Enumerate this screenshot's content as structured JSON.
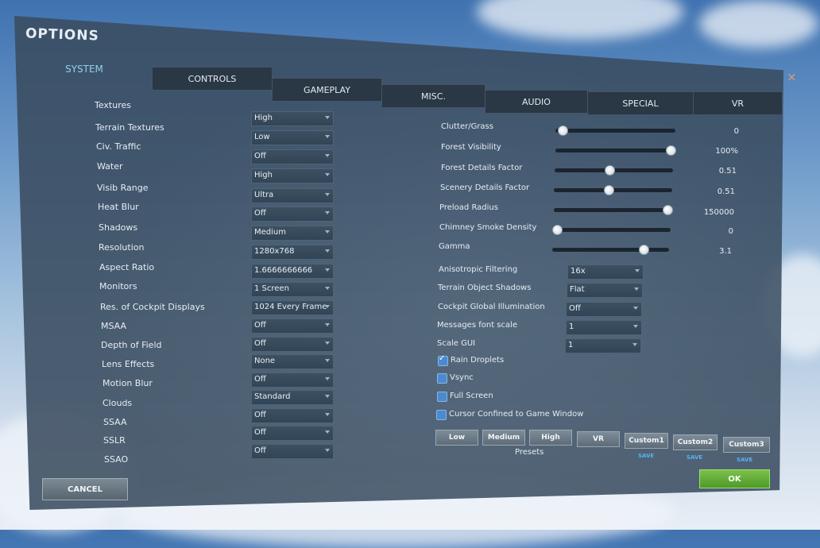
{
  "window": {
    "title": "OPTIONS",
    "close_glyph": "×"
  },
  "tabs": [
    {
      "label": "SYSTEM",
      "active": true
    },
    {
      "label": "CONTROLS"
    },
    {
      "label": "GAMEPLAY"
    },
    {
      "label": "MISC."
    },
    {
      "label": "AUDIO"
    },
    {
      "label": "SPECIAL"
    },
    {
      "label": "VR"
    }
  ],
  "left_settings": [
    {
      "label": "Textures",
      "value": "High"
    },
    {
      "label": "Terrain Textures",
      "value": "Low"
    },
    {
      "label": "Civ. Traffic",
      "value": "Off"
    },
    {
      "label": "Water",
      "value": "High"
    },
    {
      "label": "Visib Range",
      "value": "Ultra"
    },
    {
      "label": "Heat Blur",
      "value": "Off"
    },
    {
      "label": "Shadows",
      "value": "Medium"
    },
    {
      "label": "Resolution",
      "value": "1280x768"
    },
    {
      "label": "Aspect Ratio",
      "value": "1.6666666666"
    },
    {
      "label": "Monitors",
      "value": "1 Screen"
    },
    {
      "label": "Res. of Cockpit Displays",
      "value": "1024 Every Frame"
    },
    {
      "label": "MSAA",
      "value": "Off"
    },
    {
      "label": "Depth of Field",
      "value": "Off"
    },
    {
      "label": "Lens Effects",
      "value": "None"
    },
    {
      "label": "Motion Blur",
      "value": "Off"
    },
    {
      "label": "Clouds",
      "value": "Standard"
    },
    {
      "label": "SSAA",
      "value": "Off"
    },
    {
      "label": "SSLR",
      "value": "Off"
    },
    {
      "label": "SSAO",
      "value": "Off"
    }
  ],
  "sliders": [
    {
      "label": "Clutter/Grass",
      "value": "0",
      "level": 0.03
    },
    {
      "label": "Forest Visibility",
      "value": "100%",
      "level": 1.0
    },
    {
      "label": "Forest Details Factor",
      "value": "0.51",
      "level": 0.46
    },
    {
      "label": "Scenery Details Factor",
      "value": "0.51",
      "level": 0.46
    },
    {
      "label": "Preload Radius",
      "value": "150000",
      "level": 1.0
    },
    {
      "label": "Chimney Smoke Density",
      "value": "0",
      "level": 0.0
    },
    {
      "label": "Gamma",
      "value": "3.1",
      "level": 0.8
    }
  ],
  "right_dropdowns": [
    {
      "label": "Anisotropic Filtering",
      "value": "16x"
    },
    {
      "label": "Terrain Object Shadows",
      "value": "Flat"
    },
    {
      "label": "Cockpit Global Illumination",
      "value": "Off"
    },
    {
      "label": "Messages font scale",
      "value": "1"
    },
    {
      "label": "Scale GUI",
      "value": "1"
    }
  ],
  "checkboxes": [
    {
      "label": "Rain Droplets",
      "checked": true
    },
    {
      "label": "Vsync",
      "checked": false
    },
    {
      "label": "Full Screen",
      "checked": false
    },
    {
      "label": "Cursor Confined to Game Window",
      "checked": false
    }
  ],
  "presets": {
    "caption": "Presets",
    "buttons": [
      "Low",
      "Medium",
      "High",
      "VR",
      "Custom1",
      "Custom2",
      "Custom3"
    ],
    "save_label": "SAVE"
  },
  "footer": {
    "cancel_label": "CANCEL",
    "ok_label": "OK"
  },
  "colors": {
    "panel": "#3a4c60",
    "accent_tab": "#8fd0e8",
    "ok_green": "#5fa832",
    "save_blue": "#5ab0f0",
    "checkbox_blue": "#4b8ad0"
  }
}
